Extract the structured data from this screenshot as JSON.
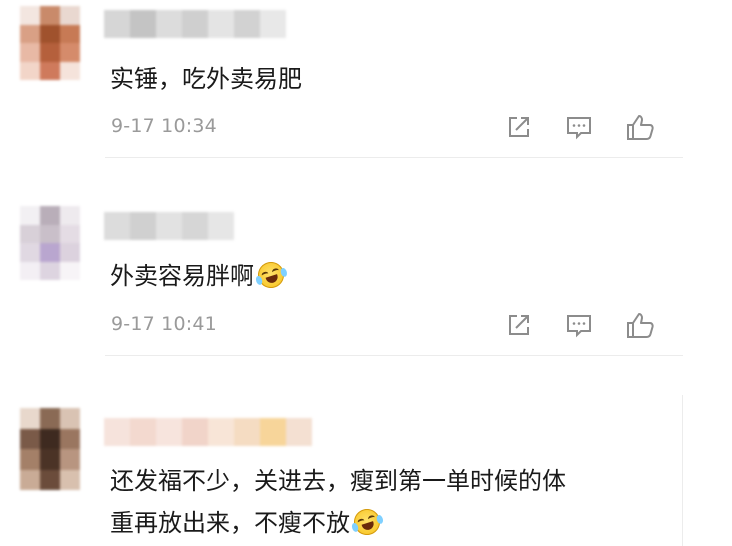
{
  "comments": [
    {
      "text": "实锤，吃外卖易肥",
      "time": "9-17 10:34",
      "actions": [
        "share-icon",
        "comment-icon",
        "like-icon"
      ]
    },
    {
      "text": "外卖容易胖啊",
      "emoji": "laugh-cry-emoji",
      "time": "9-17 10:41",
      "actions": [
        "share-icon",
        "comment-icon",
        "like-icon"
      ]
    },
    {
      "text_line1": "还发福不少，关进去，瘦到第一单时候的体",
      "text_line2": "重再放出来，不瘦不放",
      "emoji": "laugh-cry-emoji"
    }
  ],
  "colors": {
    "text": "#1a1a1a",
    "meta": "#9a9a9a",
    "icon": "#8c8c8c",
    "divider": "#ececec"
  }
}
